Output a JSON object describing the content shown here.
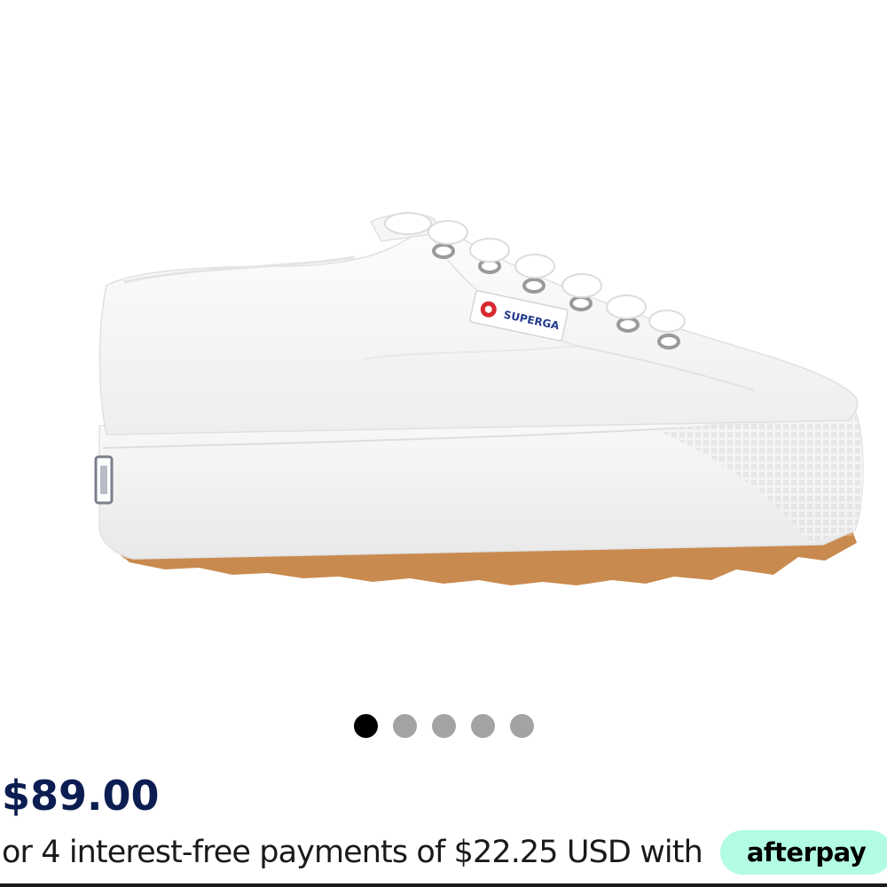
{
  "product": {
    "brand_label": "SUPERGA",
    "image_icon": "sneaker-product-photo"
  },
  "carousel": {
    "dot_count": 5,
    "active_index": 0,
    "colors": {
      "active": "#000000",
      "inactive": "#a3a3a3"
    }
  },
  "pricing": {
    "price": "$89.00",
    "installments_text": "or 4 interest-free payments of $22.25 USD with",
    "afterpay_label": "afterpay",
    "colors": {
      "price": "#0b1d51",
      "afterpay_badge": "#b2fce4"
    }
  }
}
